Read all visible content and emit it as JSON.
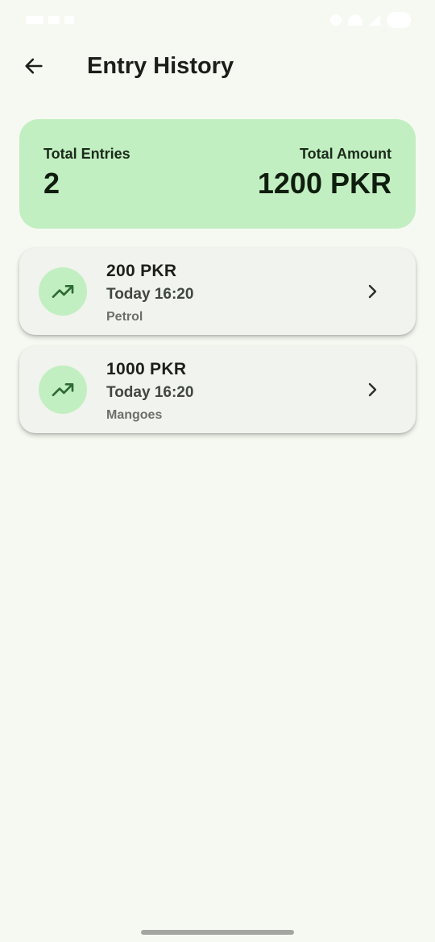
{
  "header": {
    "title": "Entry History"
  },
  "summary": {
    "total_entries_label": "Total Entries",
    "total_entries_value": "2",
    "total_amount_label": "Total Amount",
    "total_amount_value": "1200 PKR"
  },
  "entries": [
    {
      "amount": "200 PKR",
      "time": "Today 16:20",
      "description": "Petrol",
      "icon": "trending-up-icon"
    },
    {
      "amount": "1000 PKR",
      "time": "Today 16:20",
      "description": "Mangoes",
      "icon": "trending-up-icon"
    }
  ],
  "colors": {
    "background": "#f6f9f1",
    "summary_card": "#c2efc1",
    "entry_card": "#f1f3ee",
    "icon_circle": "#c2efc1",
    "icon_stroke": "#2e6b34"
  }
}
